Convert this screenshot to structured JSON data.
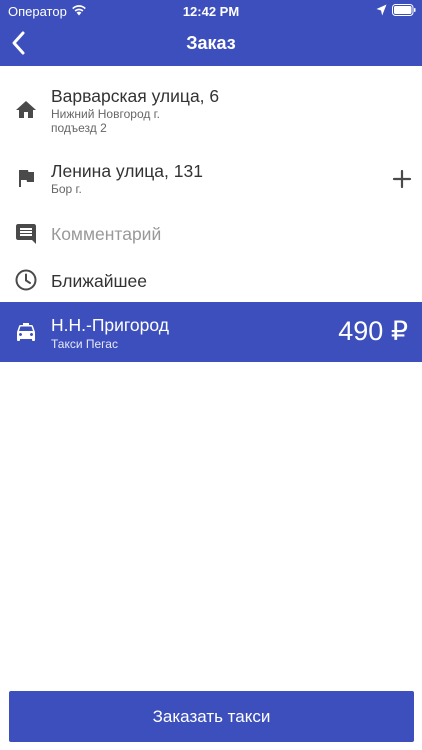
{
  "status_bar": {
    "carrier": "Оператор",
    "time": "12:42 PM"
  },
  "nav": {
    "title": "Заказ"
  },
  "pickup": {
    "address": "Варварская улица, 6",
    "city": "Нижний Новгород г.",
    "entrance": "подъезд 2",
    "icon": "home-icon"
  },
  "destination": {
    "address": "Ленина улица, 131",
    "city": "Бор г.",
    "icon": "flag-icon",
    "add_icon": "plus-icon"
  },
  "comment": {
    "placeholder": "Комментарий",
    "icon": "comment-icon"
  },
  "time_option": {
    "label": "Ближайшее",
    "icon": "clock-icon"
  },
  "tariff": {
    "name": "Н.Н.-Пригород",
    "provider": "Такси Пегас",
    "price": "490 ₽",
    "icon": "taxi-icon"
  },
  "order_button": {
    "label": "Заказать такси"
  },
  "colors": {
    "accent": "#3d4fbd",
    "icon": "#4a4a4a"
  }
}
